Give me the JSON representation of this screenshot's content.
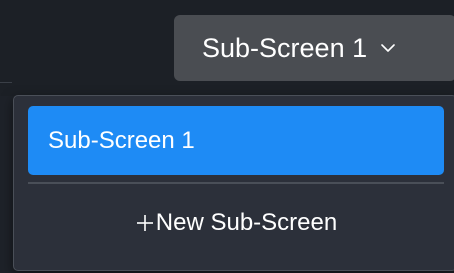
{
  "selector": {
    "current_label": "Sub-Screen 1",
    "chevron_icon": "chevron-down-icon"
  },
  "dropdown": {
    "options": [
      {
        "label": "Sub-Screen 1",
        "selected": true
      }
    ],
    "new_item": {
      "icon": "plus-icon",
      "label": "New Sub-Screen"
    }
  },
  "colors": {
    "background": "#1e2229",
    "selector_bg": "#4a4d52",
    "panel_bg": "#2c303a",
    "accent": "#1e8bf5",
    "text": "#ffffff"
  }
}
